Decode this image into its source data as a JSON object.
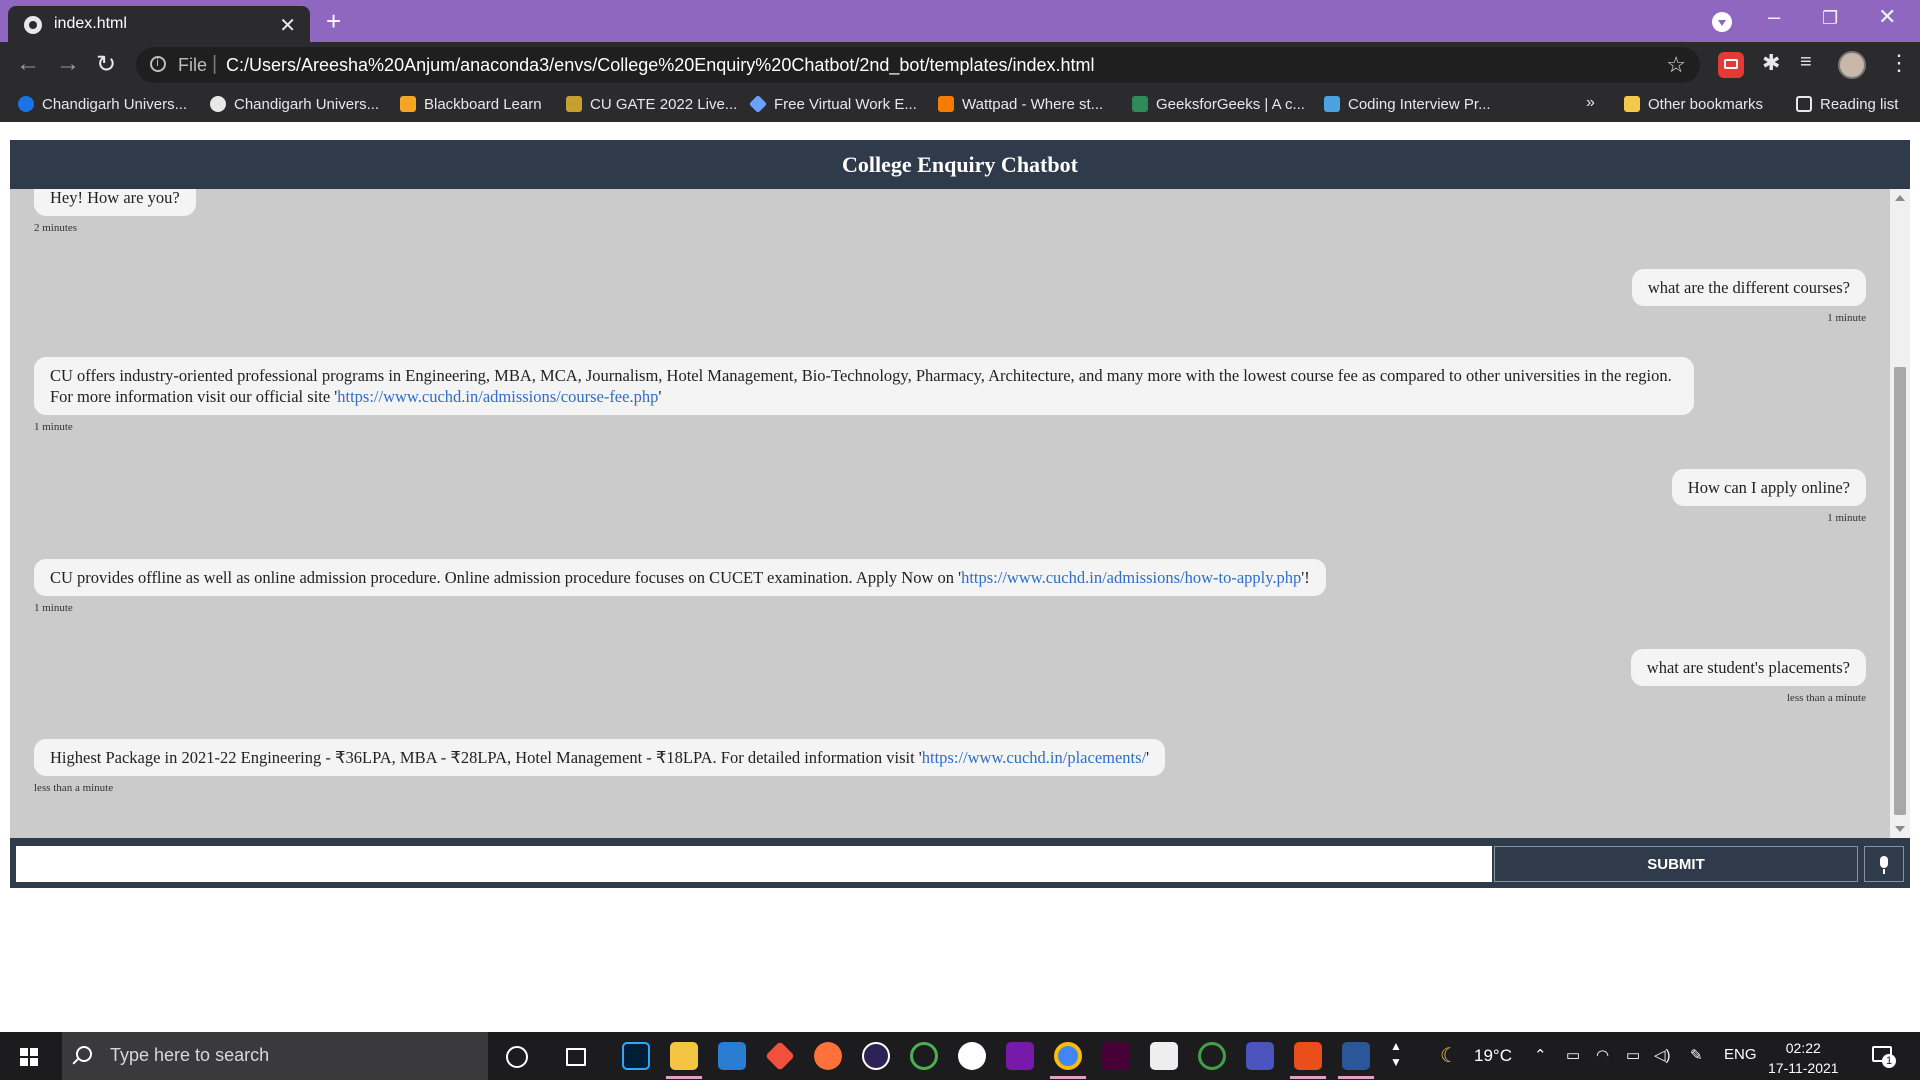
{
  "browser": {
    "tab_title": "index.html",
    "url_scheme": "File",
    "url": "C:/Users/Areesha%20Anjum/anaconda3/envs/College%20Enquiry%20Chatbot/2nd_bot/templates/index.html",
    "bookmarks": [
      {
        "label": "Chandigarh Univers...",
        "icon": "chandigarh-c-icon",
        "color": "#1a73e8"
      },
      {
        "label": "Chandigarh Univers...",
        "icon": "globe-icon",
        "color": "#e8e8e8"
      },
      {
        "label": "Blackboard Learn",
        "icon": "blackboard-icon",
        "color": "#f5a623"
      },
      {
        "label": "CU GATE 2022 Live...",
        "icon": "gate-icon",
        "color": "#c8a032"
      },
      {
        "label": "Free Virtual Work E...",
        "icon": "diamond-icon",
        "color": "#6aa0ff"
      },
      {
        "label": "Wattpad - Where st...",
        "icon": "wattpad-icon",
        "color": "#f57c00"
      },
      {
        "label": "GeeksforGeeks | A c...",
        "icon": "gfg-icon",
        "color": "#2e8b57"
      },
      {
        "label": "Coding Interview Pr...",
        "icon": "stack-icon",
        "color": "#4aa3df"
      }
    ],
    "more_bookmarks": "»",
    "other_bookmarks": "Other bookmarks",
    "reading_list": "Reading list"
  },
  "chat": {
    "title": "College Enquiry Chatbot",
    "messages": [
      {
        "side": "left",
        "text": "Hey! How are you?",
        "time": "2 minutes"
      },
      {
        "side": "right",
        "text": "what are the different courses?",
        "time": "1 minute"
      },
      {
        "side": "left",
        "text_before": "CU offers industry-oriented professional programs in Engineering, MBA, MCA, Journalism, Hotel Management, Bio-Technology, Pharmacy, Architecture, and many more with the lowest course fee as compared to other universities in the region. For more information visit our official site '",
        "link": "https://www.cuchd.in/admissions/course-fee.php",
        "text_after": "'",
        "time": "1 minute"
      },
      {
        "side": "right",
        "text": "How can I apply online?",
        "time": "1 minute"
      },
      {
        "side": "left",
        "text_before": "CU provides offline as well as online admission procedure. Online admission procedure focuses on CUCET examination. Apply Now on '",
        "link": "https://www.cuchd.in/admissions/how-to-apply.php",
        "text_after": "'!",
        "time": "1 minute"
      },
      {
        "side": "right",
        "text": "what are student's placements?",
        "time": "less than a minute"
      },
      {
        "side": "left",
        "text_before": "Highest Package in 2021-22 Engineering - ₹36LPA, MBA - ₹28LPA, Hotel Management - ₹18LPA. For detailed information visit '",
        "link": "https://www.cuchd.in/placements/",
        "text_after": "'",
        "time": "less than a minute"
      }
    ],
    "input_value": "",
    "submit_label": "SUBMIT"
  },
  "taskbar": {
    "search_placeholder": "Type here to search",
    "weather": "19°C",
    "language": "ENG",
    "time": "02:22",
    "date": "17-11-2021",
    "notification_count": "1"
  },
  "colors": {
    "header_bg": "#2f3a4a",
    "chat_bg": "#cbcbcb",
    "bubble_bg": "#f4f4f4",
    "link": "#2d6fc8",
    "tabstrip": "#8f67c0"
  }
}
